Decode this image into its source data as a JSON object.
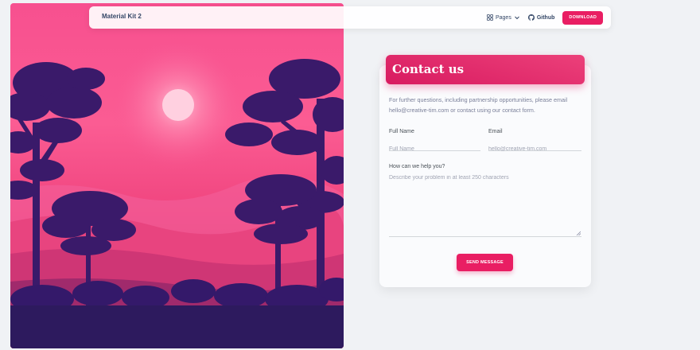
{
  "navbar": {
    "brand": "Material Kit 2",
    "pages_label": "Pages",
    "github_label": "Github",
    "download_label": "DOWNLOAD"
  },
  "contact": {
    "title": "Contact us",
    "description": "For further questions, including partnership opportunities, please email hello@creative-tim.com or contact using our contact form.",
    "full_name_label": "Full Name",
    "full_name_placeholder": "Full Name",
    "email_label": "Email",
    "email_placeholder": "hello@creative-tim.com",
    "message_label": "How can we help you?",
    "message_placeholder": "Describe your problem in at least 250 characters",
    "send_label": "SEND MESSAGE"
  },
  "colors": {
    "accent": "#e91e63",
    "background": "#f0f2f5",
    "hero_sky": "#f7508f",
    "hero_trees": "#3a1a6a"
  },
  "icons": [
    "grid-icon",
    "chevron-down-icon",
    "github-icon",
    "sun-icon",
    "resize-handle-icon"
  ]
}
